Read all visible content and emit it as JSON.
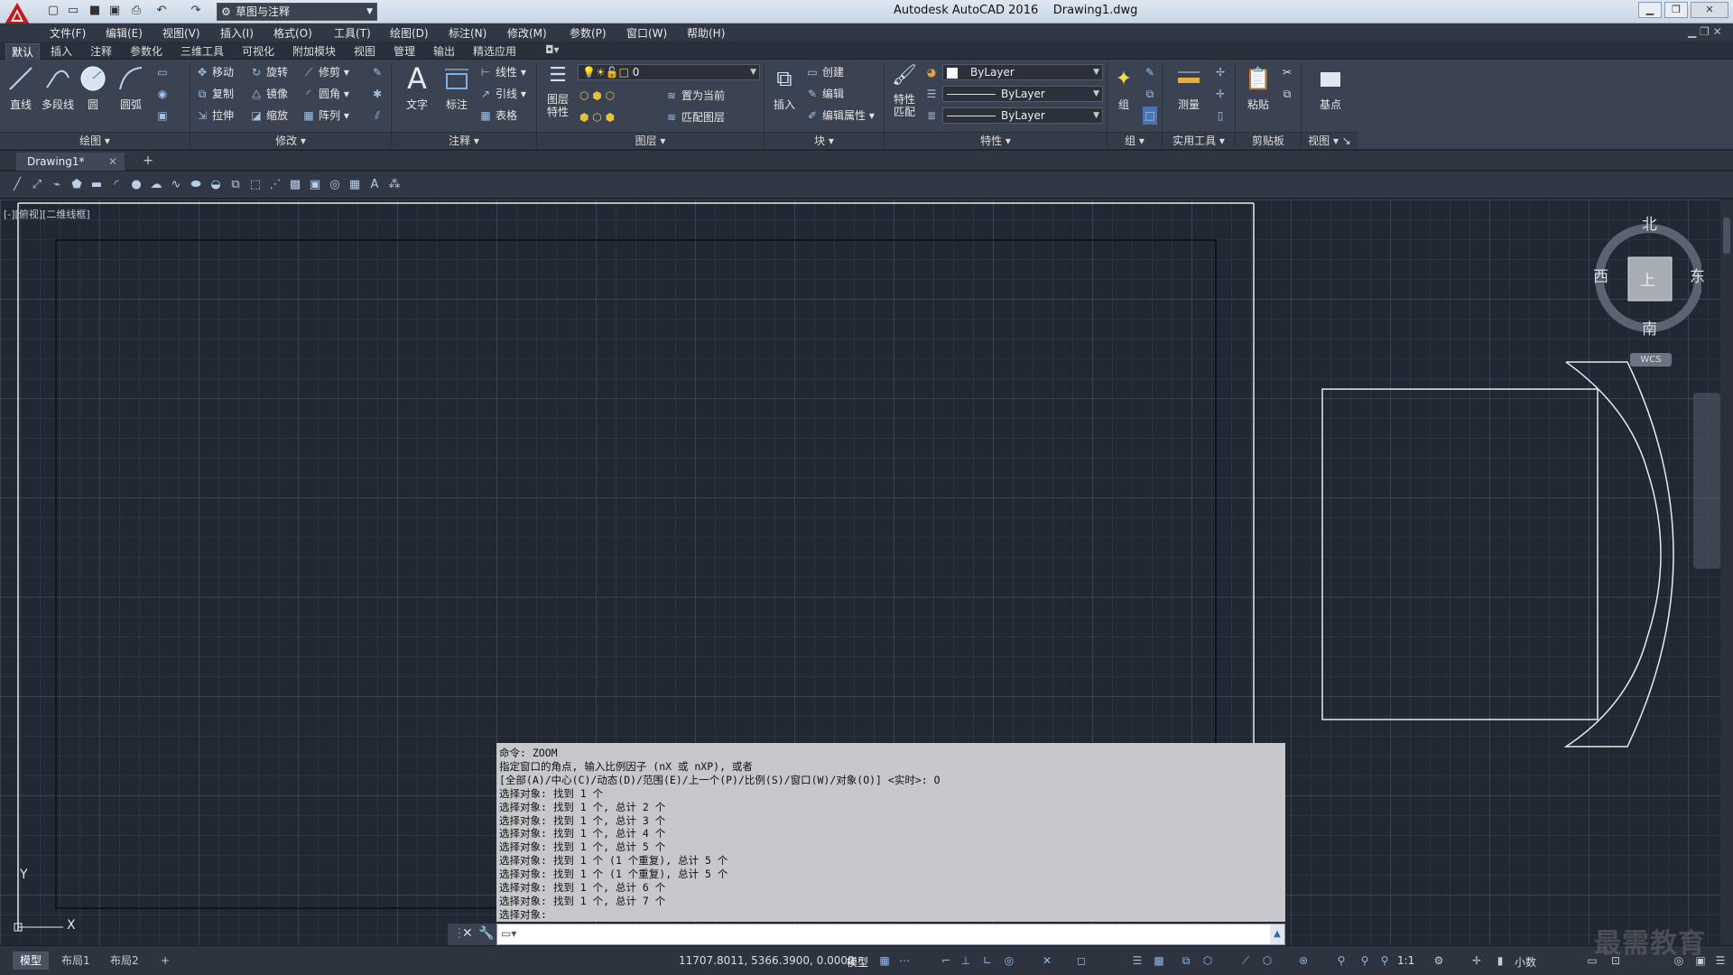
{
  "title_bar": {
    "title": "Autodesk AutoCAD 2016    Drawing1.dwg",
    "workspace": "草图与注释"
  },
  "menu": [
    "文件(F)",
    "编辑(E)",
    "视图(V)",
    "插入(I)",
    "格式(O)",
    "工具(T)",
    "绘图(D)",
    "标注(N)",
    "修改(M)",
    "参数(P)",
    "窗口(W)",
    "帮助(H)"
  ],
  "ribbon_tabs": [
    "默认",
    "插入",
    "注释",
    "参数化",
    "三维工具",
    "可视化",
    "附加模块",
    "视图",
    "管理",
    "输出",
    "精选应用"
  ],
  "ribbon": {
    "draw": {
      "title": "绘图",
      "line": "直线",
      "polyline": "多段线",
      "circle": "圆",
      "arc": "圆弧"
    },
    "modify": {
      "title": "修改",
      "move": "移动",
      "rotate": "旋转",
      "trim": "修剪",
      "copy": "复制",
      "mirror": "镜像",
      "fillet": "圆角",
      "stretch": "拉伸",
      "scale": "缩放",
      "array": "阵列"
    },
    "annotation": {
      "title": "注释",
      "text": "文字",
      "dimension": "标注",
      "linear": "线性",
      "leader": "引线",
      "table": "表格"
    },
    "layers": {
      "title": "图层",
      "layer_props": "图层\n特性",
      "layer_value": "0",
      "set_current": "置为当前",
      "match_layer": "匹配图层"
    },
    "block": {
      "title": "块",
      "insert": "插入",
      "create": "创建",
      "edit": "编辑",
      "edit_attr": "编辑属性"
    },
    "properties": {
      "title": "特性",
      "match": "特性\n匹配",
      "color": "ByLayer",
      "linetype": "ByLayer",
      "lineweight": "ByLayer"
    },
    "groups": {
      "title": "组",
      "group": "组"
    },
    "utilities": {
      "title": "实用工具",
      "measure": "测量"
    },
    "clipboard": {
      "title": "剪贴板",
      "paste": "粘贴"
    },
    "view": {
      "title": "视图",
      "base": "基点"
    }
  },
  "doc_tab": "Drawing1*",
  "viewport_label": "[-][俯视][二维线框]",
  "viewcube": {
    "north": "北",
    "south": "南",
    "east": "东",
    "west": "西",
    "face": "上",
    "wcs": "WCS"
  },
  "command_history": [
    "命令: ZOOM",
    "指定窗口的角点, 输入比例因子 (nX 或 nXP), 或者",
    "[全部(A)/中心(C)/动态(D)/范围(E)/上一个(P)/比例(S)/窗口(W)/对象(O)] <实时>: O",
    "选择对象: 找到 1 个",
    "选择对象: 找到 1 个, 总计 2 个",
    "选择对象: 找到 1 个, 总计 3 个",
    "选择对象: 找到 1 个, 总计 4 个",
    "选择对象: 找到 1 个, 总计 5 个",
    "选择对象: 找到 1 个 (1 个重复), 总计 5 个",
    "选择对象: 找到 1 个 (1 个重复), 总计 5 个",
    "选择对象: 找到 1 个, 总计 6 个",
    "选择对象: 找到 1 个, 总计 7 个",
    "选择对象:"
  ],
  "status": {
    "layout_tabs": [
      "模型",
      "布局1",
      "布局2"
    ],
    "coords": "11707.8011, 5366.3900, 0.0000",
    "model": "模型",
    "scale": "1:1",
    "units": "小数"
  },
  "watermark": "最需教育"
}
